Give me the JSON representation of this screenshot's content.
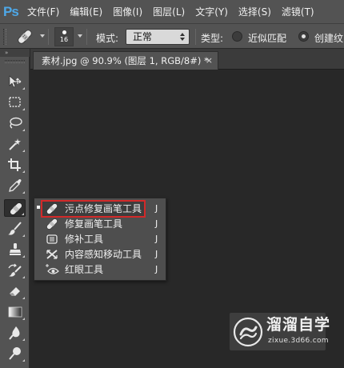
{
  "menubar": {
    "logo": "Ps",
    "items": [
      "文件(F)",
      "编辑(E)",
      "图像(I)",
      "图层(L)",
      "文字(Y)",
      "选择(S)",
      "滤镜(T)"
    ]
  },
  "options": {
    "brush_size": "16",
    "mode_label": "模式:",
    "mode_value": "正常",
    "type_label": "类型:",
    "type_options": [
      "近似匹配",
      "创建纹"
    ],
    "type_selected": "创建纹"
  },
  "document_tab": {
    "title": "素材.jpg @ 90.9% (图层 1, RGB/8#) *",
    "close_glyph": "×"
  },
  "toolbar": {
    "collapse_glyph": "»",
    "tools": [
      "move-tool",
      "marquee-tool",
      "lasso-tool",
      "magic-wand-tool",
      "crop-tool",
      "eyedropper-tool",
      "spot-healing-brush-tool",
      "brush-tool",
      "clone-stamp-tool",
      "history-brush-tool",
      "eraser-tool",
      "gradient-tool",
      "blur-tool",
      "dodge-tool"
    ],
    "active_tool": "spot-healing-brush-tool"
  },
  "flyout": {
    "items": [
      {
        "label": "污点修复画笔工具",
        "key": "J",
        "icon": "spot-healing-brush-icon",
        "selected": true
      },
      {
        "label": "修复画笔工具",
        "key": "J",
        "icon": "healing-brush-icon",
        "selected": false
      },
      {
        "label": "修补工具",
        "key": "J",
        "icon": "patch-icon",
        "selected": false
      },
      {
        "label": "内容感知移动工具",
        "key": "J",
        "icon": "content-aware-move-icon",
        "selected": false
      },
      {
        "label": "红眼工具",
        "key": "J",
        "icon": "red-eye-icon",
        "selected": false
      }
    ],
    "highlight_color": "#d22929"
  },
  "watermark": {
    "title": "溜溜自学",
    "url": "zixue.3d66.com"
  },
  "colors": {
    "panel": "#535353",
    "canvas": "#282828",
    "ps_blue": "#4ea8e8"
  }
}
